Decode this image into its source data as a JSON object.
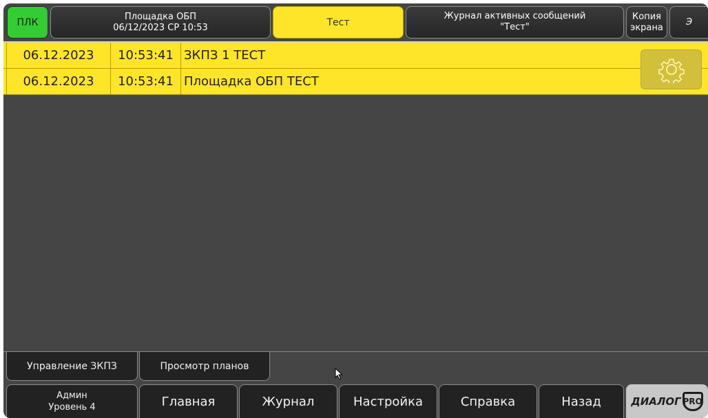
{
  "topbar": {
    "plc_label": "ПЛК",
    "site_name": "Площадка ОБП",
    "site_datetime": "06/12/2023 СР 10:53",
    "test_label": "Тест",
    "journal_line1": "Журнал активных сообщений",
    "journal_line2": "\"Тест\"",
    "copy_line1": "Копия",
    "copy_line2": "экрана",
    "extra_label": "Э"
  },
  "messages": [
    {
      "date": "06.12.2023",
      "time": "10:53:41",
      "text": "ЗКПЗ 1 ТЕСТ"
    },
    {
      "date": "06.12.2023",
      "time": "10:53:41",
      "text": "Площадка ОБП ТЕСТ"
    }
  ],
  "icons": {
    "settings": "gear-icon",
    "cursor": "mouse-pointer-icon"
  },
  "quick": {
    "zkpz_label": "Управление ЗКПЗ",
    "plans_label": "Просмотр планов"
  },
  "nav": {
    "user_name": "Админ",
    "user_level": "Уровень 4",
    "main_label": "Главная",
    "journal_label": "Журнал",
    "settings_label": "Настройка",
    "help_label": "Справка",
    "back_label": "Назад"
  },
  "logo": {
    "brand": "ДИАЛОГ",
    "suffix": "PRO"
  },
  "colors": {
    "alarm_yellow": "#ffe52a",
    "plc_green": "#33cc33",
    "background": "#454545",
    "button_dark": "#222222"
  }
}
